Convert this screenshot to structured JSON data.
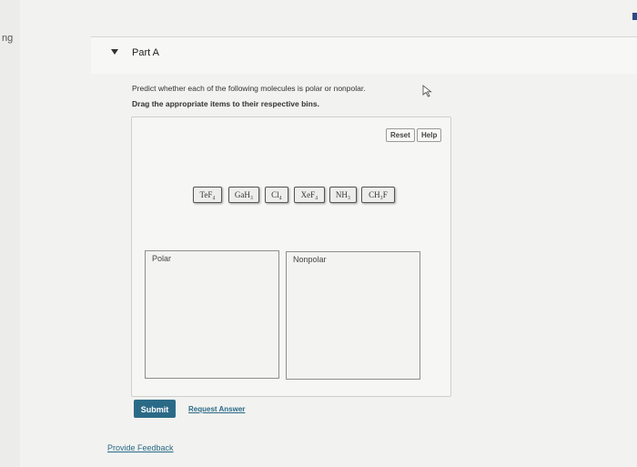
{
  "edge_text": "ng",
  "part": {
    "title": "Part A"
  },
  "question": "Predict whether each of the following molecules is polar or nonpolar.",
  "instruction": "Drag the appropriate items to their respective bins.",
  "toolbar": {
    "reset_label": "Reset",
    "help_label": "Help"
  },
  "tokens": [
    {
      "label": "TeF₄"
    },
    {
      "label": "GaH₃"
    },
    {
      "label": "Cl₄"
    },
    {
      "label": "XeF₄"
    },
    {
      "label": "NH₃"
    },
    {
      "label": "CH₃F"
    }
  ],
  "bins": [
    {
      "label": "Polar"
    },
    {
      "label": "Nonpolar"
    }
  ],
  "actions": {
    "submit_label": "Submit",
    "request_answer_label": "Request Answer"
  },
  "feedback_label": "Provide Feedback",
  "colors": {
    "accent": "#2b6a87",
    "right_mark": "#2c4a87"
  },
  "icons": [
    "chevron-down-icon",
    "mouse-cursor-icon"
  ]
}
